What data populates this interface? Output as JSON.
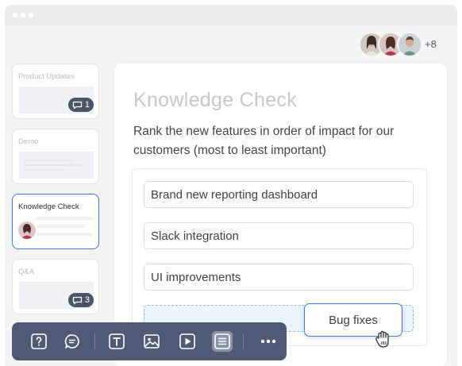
{
  "presence": {
    "extra_count": "+8"
  },
  "slides": [
    {
      "title": "Product Updates",
      "badge_count": "1"
    },
    {
      "title": "Demo"
    },
    {
      "title": "Knowledge Check"
    },
    {
      "title": "Q&A",
      "badge_count": "3"
    }
  ],
  "question": {
    "title": "Knowledge Check",
    "prompt": "Rank the new features in order of impact for our customers (most to least important)",
    "items": [
      "Brand new reporting dashboard",
      "Slack integration",
      "UI improvements"
    ],
    "dragging_item": "Bug fixes"
  },
  "toolbar": {
    "buttons": [
      "question-icon",
      "chat-icon",
      "text-icon",
      "image-icon",
      "video-icon",
      "list-icon",
      "more-icon"
    ],
    "active": "list-icon"
  },
  "colors": {
    "accent": "#3b7ae0",
    "toolbar_bg": "#515a75",
    "badge_bg": "#4c5468"
  }
}
